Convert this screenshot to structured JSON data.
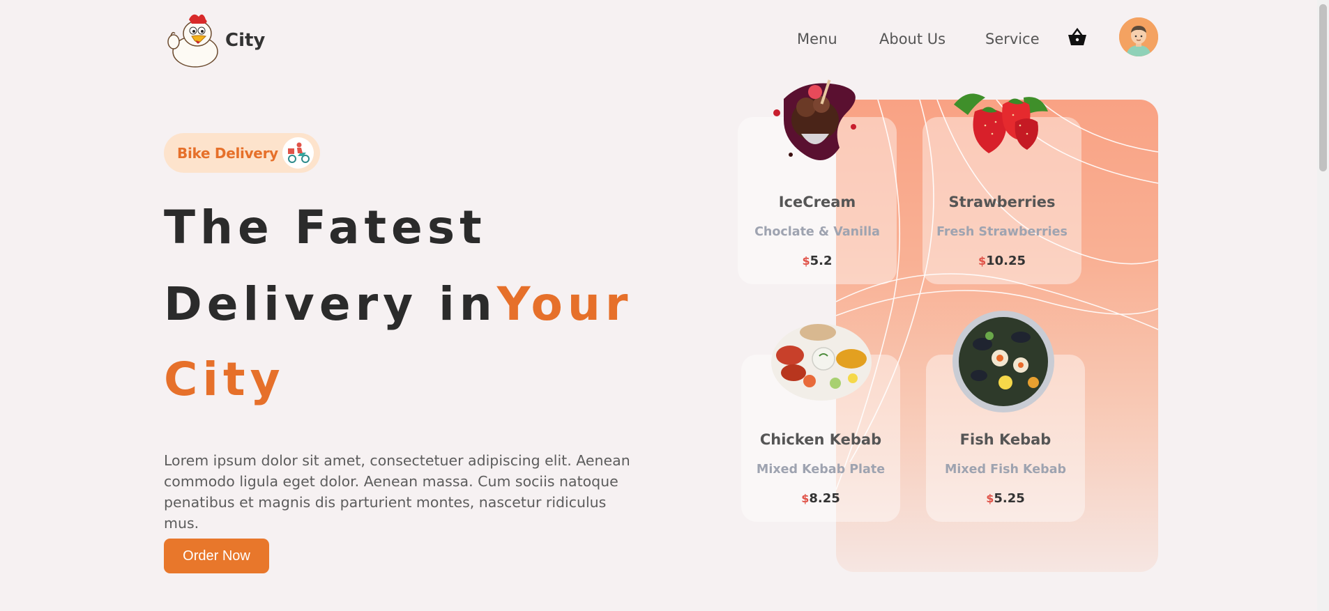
{
  "brand": {
    "name": "City"
  },
  "nav": {
    "items": [
      "Menu",
      "About Us",
      "Service"
    ]
  },
  "hero": {
    "badge": "Bike Delivery",
    "headline_line1": "The Fatest",
    "headline_line2_plain": "Delivery in",
    "headline_line2_accent": "Your",
    "headline_line3_accent": "City",
    "description": "Lorem ipsum dolor sit amet, consectetuer adipiscing elit. Aenean commodo ligula eget dolor. Aenean massa. Cum sociis natoque penatibus et magnis dis parturient montes, nascetur ridiculus mus.",
    "cta": "Order Now"
  },
  "menu_cards": [
    {
      "name": "IceCream",
      "desc": "Choclate & Vanilla",
      "currency": "$",
      "price": "5.2",
      "icon": "icecream-image"
    },
    {
      "name": "Strawberries",
      "desc": "Fresh Strawberries",
      "currency": "$",
      "price": "10.25",
      "icon": "strawberries-image"
    },
    {
      "name": "Chicken Kebab",
      "desc": "Mixed Kebab Plate",
      "currency": "$",
      "price": "8.25",
      "icon": "chicken-kebab-image"
    },
    {
      "name": "Fish Kebab",
      "desc": "Mixed Fish Kebab",
      "currency": "$",
      "price": "5.25",
      "icon": "fish-kebab-image"
    }
  ],
  "colors": {
    "accent": "#e6702a",
    "button": "#e8772b",
    "badge_bg": "#fde3cc",
    "panel": "#f9a284",
    "price_currency": "#e05349"
  },
  "icons": {
    "cart": "basket-icon",
    "avatar": "user-avatar",
    "logo": "chicken-mascot-logo",
    "badge": "scooter-rider-icon"
  }
}
